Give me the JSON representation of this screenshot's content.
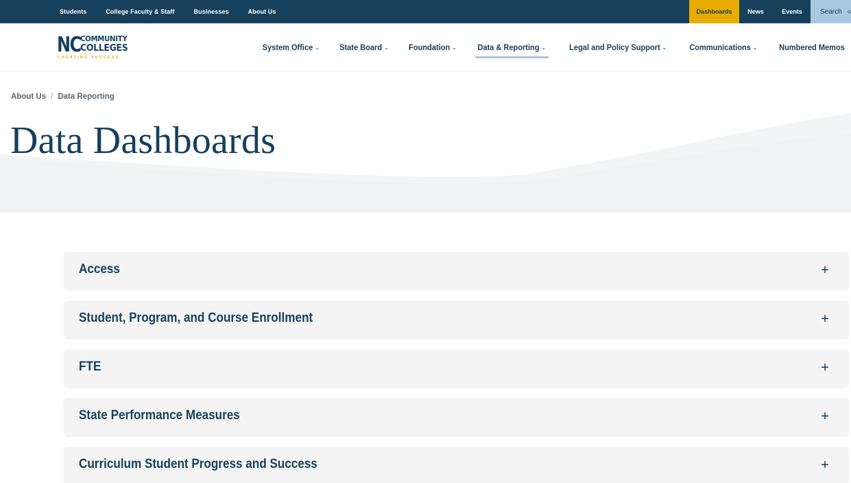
{
  "topbar": {
    "left_links": [
      "Students",
      "College Faculty & Staff",
      "Businesses",
      "About Us"
    ],
    "dashboards": "Dashboards",
    "news": "News",
    "events": "Events",
    "search": "Search",
    "search_icon": "search-icon"
  },
  "logo": {
    "nc": "NC",
    "line1": "COMMUNITY",
    "line2": "COLLEGES",
    "tagline": "CREATING SUCCESS"
  },
  "nav": {
    "items": [
      {
        "label": "System Office",
        "has_menu": true
      },
      {
        "label": "State Board",
        "has_menu": true
      },
      {
        "label": "Foundation",
        "has_menu": true
      },
      {
        "label": "Data & Reporting",
        "has_menu": true,
        "active": true
      },
      {
        "label": "Legal and Policy Support",
        "has_menu": true
      },
      {
        "label": "Communications",
        "has_menu": true
      },
      {
        "label": "Numbered Memos",
        "has_menu": false
      }
    ]
  },
  "breadcrumb": {
    "items": [
      "About Us",
      "Data Reporting"
    ],
    "separator": "/"
  },
  "page": {
    "title": "Data Dashboards"
  },
  "accordion": {
    "items": [
      {
        "label": "Access",
        "expand_symbol": "+"
      },
      {
        "label": "Student, Program, and Course Enrollment",
        "expand_symbol": "+"
      },
      {
        "label": "FTE",
        "expand_symbol": "+"
      },
      {
        "label": "State Performance Measures",
        "expand_symbol": "+"
      },
      {
        "label": "Curriculum Student Progress and Success",
        "expand_symbol": "+"
      }
    ]
  },
  "colors": {
    "navy": "#16405c",
    "gold": "#e8ac00",
    "light_blue": "#a9c7de",
    "panel": "#f4f4f4"
  }
}
